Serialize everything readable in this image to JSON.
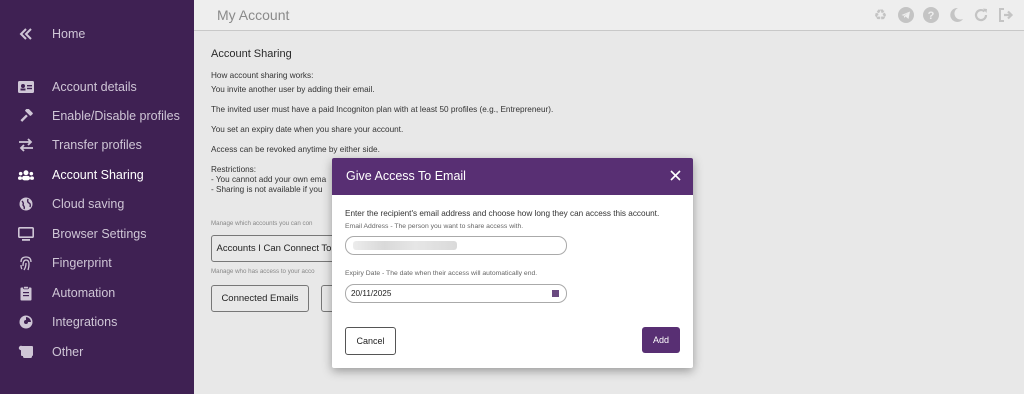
{
  "sidebar": {
    "collapse_icon": "double-chevron-left-icon",
    "items": [
      {
        "label": "Home",
        "icon": "double-chevron-left-icon"
      },
      {
        "label": "Account details",
        "icon": "id-card-icon"
      },
      {
        "label": "Enable/Disable profiles",
        "icon": "hammer-icon"
      },
      {
        "label": "Transfer profiles",
        "icon": "arrows-exchange-icon"
      },
      {
        "label": "Account Sharing",
        "icon": "users-icon"
      },
      {
        "label": "Cloud saving",
        "icon": "globe-icon"
      },
      {
        "label": "Browser Settings",
        "icon": "monitor-icon"
      },
      {
        "label": "Fingerprint",
        "icon": "fingerprint-icon"
      },
      {
        "label": "Automation",
        "icon": "clipboard-icon"
      },
      {
        "label": "Integrations",
        "icon": "puzzle-icon"
      },
      {
        "label": "Other",
        "icon": "scroll-icon"
      }
    ]
  },
  "header": {
    "title": "My Account",
    "icons": [
      "recycle-icon",
      "telegram-icon",
      "help-icon",
      "moon-icon",
      "refresh-icon",
      "logout-icon"
    ]
  },
  "content": {
    "heading": "Account Sharing",
    "how_title": "How account sharing works:",
    "line1": "You invite another user by adding their email.",
    "line2": "The invited user must have a paid Incogniton plan with at least 50 profiles (e.g., Entrepreneur).",
    "line3": "You set an expiry date when you share your account.",
    "line4": "Access can be revoked anytime by either side.",
    "restrictions_title": "Restrictions:",
    "restriction1": "- You cannot add your own ema",
    "restriction2": "- Sharing is not available if you",
    "manage_can": "Manage which accounts you can con",
    "btn_can_connect": "Accounts I Can Connect To",
    "manage_who": "Manage who has access to your acco",
    "btn_connected": "Connected Emails"
  },
  "modal": {
    "title": "Give Access To Email",
    "intro": "Enter the recipient's email address and choose how long they can access this account.",
    "email_label": "Email Address - The person you want to share access with.",
    "email_value": "",
    "expiry_label": "Expiry Date - The date when their access will automatically end.",
    "expiry_value": "20/11/2025",
    "cancel_label": "Cancel",
    "add_label": "Add",
    "accent": "#582f73"
  }
}
